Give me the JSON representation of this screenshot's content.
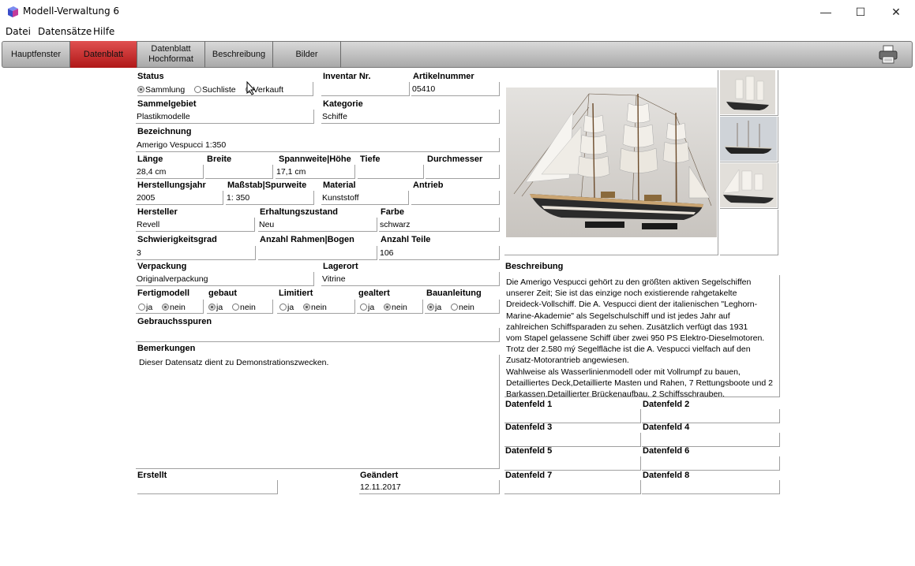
{
  "window": {
    "title": "Modell-Verwaltung 6",
    "controls": {
      "minimize": "—",
      "maximize": "☐",
      "close": "✕"
    }
  },
  "menu": [
    "Datei",
    "Datensätze",
    "Hilfe"
  ],
  "toolbar": {
    "tabs": [
      {
        "label": "Hauptfenster"
      },
      {
        "label": "Datenblatt"
      },
      {
        "label": "Datenblatt\nHochformat"
      },
      {
        "label": "Beschreibung"
      },
      {
        "label": "Bilder"
      }
    ],
    "active_tab": "Datenblatt",
    "active_color": "#c62828"
  },
  "form": {
    "status": {
      "label": "Status",
      "options": [
        "Sammlung",
        "Suchliste",
        "Verkauft"
      ],
      "selected": "Sammlung"
    },
    "inventar_nr": {
      "label": "Inventar Nr.",
      "value": ""
    },
    "artikelnummer": {
      "label": "Artikelnummer",
      "value": "05410"
    },
    "sammelgebiet": {
      "label": "Sammelgebiet",
      "value": "Plastikmodelle"
    },
    "kategorie": {
      "label": "Kategorie",
      "value": "Schiffe"
    },
    "bezeichnung": {
      "label": "Bezeichnung",
      "value": "Amerigo Vespucci 1:350"
    },
    "laenge": {
      "label": "Länge",
      "value": "28,4 cm"
    },
    "breite": {
      "label": "Breite",
      "value": ""
    },
    "spannweite": {
      "label": "Spannweite|Höhe",
      "value": "17,1 cm"
    },
    "tiefe": {
      "label": "Tiefe",
      "value": ""
    },
    "durchmesser": {
      "label": "Durchmesser",
      "value": ""
    },
    "herstellungsjahr": {
      "label": "Herstellungsjahr",
      "value": "2005"
    },
    "massstab": {
      "label": "Maßstab|Spurweite",
      "value": "1:  350"
    },
    "material": {
      "label": "Material",
      "value": "Kunststoff"
    },
    "antrieb": {
      "label": "Antrieb",
      "value": ""
    },
    "hersteller": {
      "label": "Hersteller",
      "value": "Revell"
    },
    "erhaltungszustand": {
      "label": "Erhaltungszustand",
      "value": "Neu"
    },
    "farbe": {
      "label": "Farbe",
      "value": "schwarz"
    },
    "schwierigkeitsgrad": {
      "label": "Schwierigkeitsgrad",
      "value": "3"
    },
    "anzahl_rahmen": {
      "label": "Anzahl Rahmen|Bogen",
      "value": ""
    },
    "anzahl_teile": {
      "label": "Anzahl Teile",
      "value": "106"
    },
    "verpackung": {
      "label": "Verpackung",
      "value": "Originalverpackung"
    },
    "lagerort": {
      "label": "Lagerort",
      "value": "Vitrine"
    },
    "yes_label": "ja",
    "no_label": "nein",
    "fertigmodell": {
      "label": "Fertigmodell",
      "selected": "nein"
    },
    "gebaut": {
      "label": "gebaut",
      "selected": "ja"
    },
    "limitiert": {
      "label": "Limitiert",
      "selected": "nein"
    },
    "gealtert": {
      "label": "gealtert",
      "selected": "nein"
    },
    "bauanleitung": {
      "label": "Bauanleitung",
      "selected": "ja"
    },
    "gebrauchsspuren": {
      "label": "Gebrauchsspuren",
      "value": ""
    },
    "bemerkungen": {
      "label": "Bemerkungen",
      "value": "Dieser Datensatz dient zu Demonstrationszwecken."
    },
    "erstellt": {
      "label": "Erstellt",
      "value": ""
    },
    "geaendert": {
      "label": "Geändert",
      "value": "12.11.2017"
    }
  },
  "beschreibung": {
    "label": "Beschreibung",
    "lines": [
      "Die Amerigo Vespucci gehört zu den größten aktiven Segelschiffen",
      "unserer Zeit; Sie ist das einzige noch existierende rahgetakelte",
      "Dreideck-Vollschiff. Die A. Vespucci dient der italienischen \"Leghorn-",
      "Marine-Akademie\" als Segelschulschiff und ist jedes Jahr auf",
      "zahlreichen Schiffsparaden zu sehen. Zusätzlich verfügt das 1931",
      "vom Stapel gelassene Schiff über zwei 950 PS Elektro-Dieselmotoren.",
      "Trotz der 2.580 mý Segelfläche ist die A. Vespucci vielfach auf den",
      "Zusatz-Motorantrieb angewiesen.",
      "Wahlweise als Wasserlinienmodell oder mit Vollrumpf zu bauen,",
      "Detailliertes Deck,Detaillierte Masten und Rahen, 7 Rettungsboote und 2",
      "Barkassen.Detaillierter Brückenaufbau. 2 Schiffsschrauben."
    ]
  },
  "datenfelder": [
    {
      "label": "Datenfeld 1",
      "value": ""
    },
    {
      "label": "Datenfeld 2",
      "value": ""
    },
    {
      "label": "Datenfeld 3",
      "value": ""
    },
    {
      "label": "Datenfeld 4",
      "value": ""
    },
    {
      "label": "Datenfeld 5",
      "value": ""
    },
    {
      "label": "Datenfeld 6",
      "value": ""
    },
    {
      "label": "Datenfeld 7",
      "value": ""
    },
    {
      "label": "Datenfeld 8",
      "value": ""
    }
  ],
  "images": {
    "main": "ship-photo",
    "thumbnails": [
      "ship-thumb-1",
      "ship-thumb-2",
      "ship-thumb-3",
      "empty-thumb"
    ]
  },
  "icons": {
    "app": "app-cube-icon",
    "printer": "printer-icon"
  }
}
